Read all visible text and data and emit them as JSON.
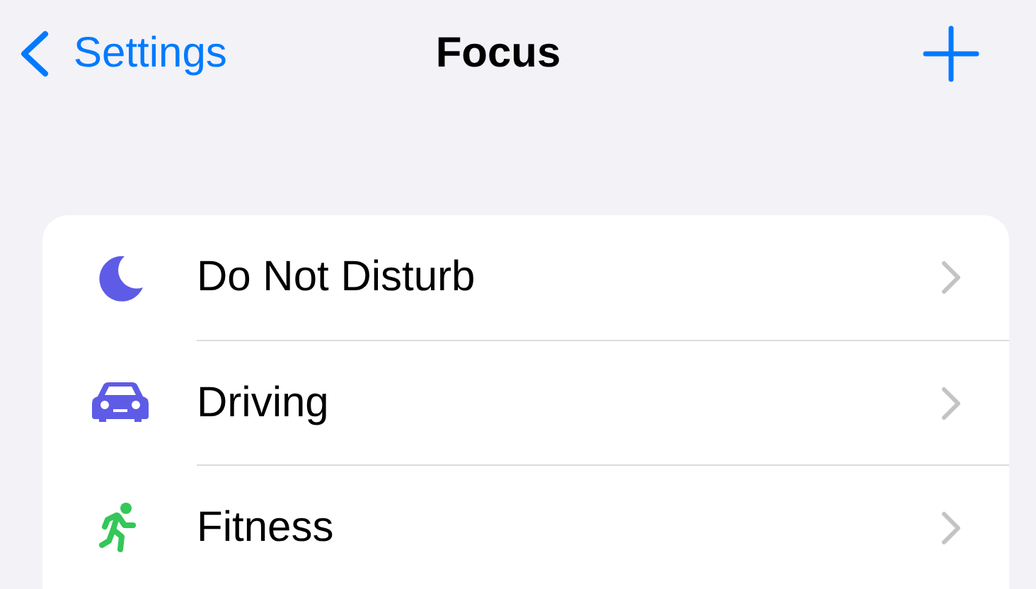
{
  "nav": {
    "back_label": "Settings",
    "title": "Focus"
  },
  "focus_modes": [
    {
      "label": "Do Not Disturb"
    },
    {
      "label": "Driving"
    },
    {
      "label": "Fitness"
    }
  ]
}
